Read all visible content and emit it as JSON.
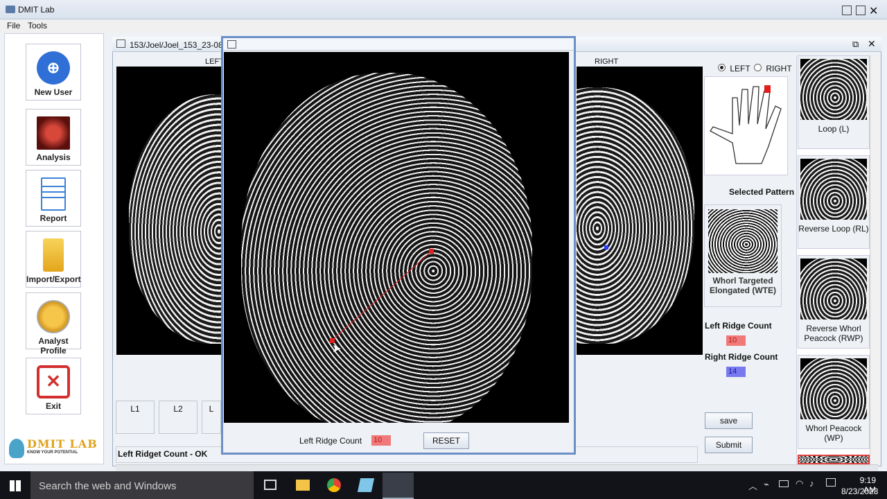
{
  "app": {
    "title": "DMIT Lab"
  },
  "menu": [
    "File",
    "Tools"
  ],
  "sidebar": {
    "items": [
      {
        "label": "New User",
        "icon": "add-user-icon",
        "color": "#2f6fd6"
      },
      {
        "label": "Analysis",
        "icon": "fingerprint-scan-icon",
        "color": "#c0392b"
      },
      {
        "label": "Report",
        "icon": "document-icon",
        "color": "#3b82d6"
      },
      {
        "label": "Import/Export",
        "icon": "folder-icon",
        "color": "#f0b62c"
      },
      {
        "label": "Analyst Profile",
        "icon": "analyst-profile-icon",
        "color": "#f0a81c"
      },
      {
        "label": "Exit",
        "icon": "close-icon",
        "color": "#d32f2f"
      }
    ],
    "logo": {
      "brand": "DMIT LAB",
      "tagline": "KNOW YOUR POTENTIAL"
    }
  },
  "inner_window": {
    "title": "153/Joel/Joel_153_23-08",
    "left_header": "LEFT",
    "right_header": "RIGHT",
    "finger_boxes": [
      "L1",
      "L2",
      "L"
    ],
    "status": "Left Ridget Count - OK"
  },
  "controls": {
    "hand_left": "LEFT",
    "hand_right": "RIGHT",
    "hand_selected": "LEFT",
    "selected_pattern_label": "Selected Pattern",
    "selected_pattern_name": "Whorl Targeted Elongated (WTE)",
    "left_ridge_label": "Left Ridge Count",
    "left_ridge_value": "10",
    "right_ridge_label": "Right Ridge Count",
    "right_ridge_value": "14",
    "save": "save",
    "submit": "Submit",
    "left_ridge_color": "#f07a7a",
    "right_ridge_color": "#7a7af0"
  },
  "patterns": [
    "Loop (L)",
    "Reverse Loop (RL)",
    "Reverse Whorl Peacock (RWP)",
    "Whorl Peacock (WP)"
  ],
  "popup": {
    "ridge_label": "Left Ridge Count",
    "ridge_value": "10",
    "reset": "RESET"
  },
  "taskbar": {
    "search_placeholder": "Search the web and Windows",
    "time": "9:19 AM",
    "date": "8/23/2023"
  }
}
